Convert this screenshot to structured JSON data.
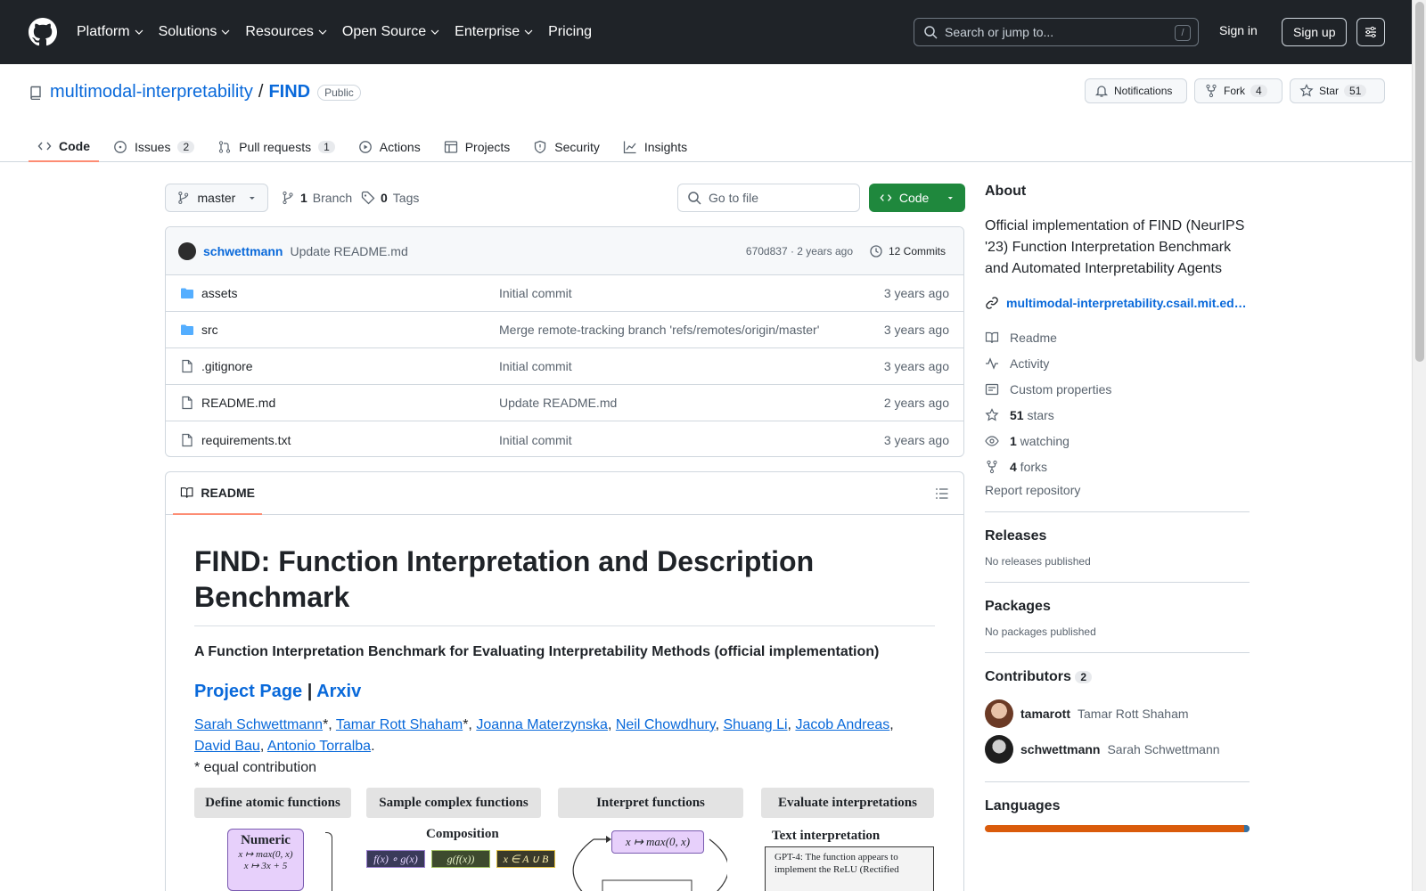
{
  "header": {
    "nav": [
      "Platform",
      "Solutions",
      "Resources",
      "Open Source",
      "Enterprise",
      "Pricing"
    ],
    "search_placeholder": "Search or jump to...",
    "search_shortcut": "/",
    "signin": "Sign in",
    "signup": "Sign up"
  },
  "repo": {
    "owner": "multimodal-interpretability",
    "separator": "/",
    "name": "FIND",
    "visibility": "Public",
    "notifications": "Notifications",
    "fork_label": "Fork",
    "fork_count": "4",
    "star_label": "Star",
    "star_count": "51"
  },
  "tabs": [
    {
      "label": "Code",
      "count": ""
    },
    {
      "label": "Issues",
      "count": "2"
    },
    {
      "label": "Pull requests",
      "count": "1"
    },
    {
      "label": "Actions",
      "count": ""
    },
    {
      "label": "Projects",
      "count": ""
    },
    {
      "label": "Security",
      "count": ""
    },
    {
      "label": "Insights",
      "count": ""
    }
  ],
  "toolbar": {
    "branch": "master",
    "branch_count": "1",
    "branch_label": "Branch",
    "tag_count": "0",
    "tag_label": "Tags",
    "goto_placeholder": "Go to file",
    "code_button": "Code"
  },
  "commit": {
    "author": "schwettmann",
    "message": "Update README.md",
    "hash_time": "670d837 · 2 years ago",
    "commits": "12 Commits"
  },
  "files": [
    {
      "name": "assets",
      "type": "folder",
      "message": "Initial commit",
      "date": "3 years ago"
    },
    {
      "name": "src",
      "type": "folder",
      "message": "Merge remote-tracking branch 'refs/remotes/origin/master'",
      "date": "3 years ago"
    },
    {
      "name": ".gitignore",
      "type": "file",
      "message": "Initial commit",
      "date": "3 years ago"
    },
    {
      "name": "README.md",
      "type": "file",
      "message": "Update README.md",
      "date": "2 years ago"
    },
    {
      "name": "requirements.txt",
      "type": "file",
      "message": "Initial commit",
      "date": "3 years ago"
    }
  ],
  "readme": {
    "tab": "README",
    "title": "FIND: Function Interpretation and Description Benchmark",
    "subtitle": "A Function Interpretation Benchmark for Evaluating Interpretability Methods (official implementation)",
    "link_project": "Project Page",
    "link_sep": "|",
    "link_arxiv": "Arxiv",
    "authors": [
      {
        "name": "Sarah Schwettmann",
        "suffix": "*, "
      },
      {
        "name": "Tamar Rott Shaham",
        "suffix": "*, "
      },
      {
        "name": "Joanna Materzynska",
        "suffix": ", "
      },
      {
        "name": "Neil Chowdhury",
        "suffix": ", "
      },
      {
        "name": "Shuang Li",
        "suffix": ", "
      },
      {
        "name": "Jacob Andreas",
        "suffix": ", "
      },
      {
        "name": "David Bau",
        "suffix": ", "
      },
      {
        "name": "Antonio Torralba",
        "suffix": "."
      }
    ],
    "note": "* equal contribution",
    "figure": {
      "headers": [
        "Define atomic functions",
        "Sample complex functions",
        "Interpret functions",
        "Evaluate interpretations"
      ],
      "numeric": "Numeric",
      "composition": "Composition",
      "ops": [
        "f(x) ∘ g(x)",
        "g(f(x))",
        "x ∈ A ∪ B"
      ],
      "relu": "x ↦ max(0, x)",
      "atomic_1": "x ↦ max(0, x)",
      "atomic_2": "x ↦ 3x + 5",
      "text_interp": "Text interpretation",
      "gpt4": "GPT-4: The function appears to implement the ReLU (Rectified"
    }
  },
  "about": {
    "heading": "About",
    "description": "Official implementation of FIND (NeurIPS '23) Function Interpretation Benchmark and Automated Interpretability Agents",
    "website": "multimodal-interpretability.csail.mit.ed…",
    "items": [
      {
        "icon": "book-icon",
        "bold": "",
        "text": "Readme"
      },
      {
        "icon": "pulse-icon",
        "bold": "",
        "text": "Activity"
      },
      {
        "icon": "note-icon",
        "bold": "",
        "text": "Custom properties"
      },
      {
        "icon": "star-icon",
        "bold": "51",
        "text": " stars"
      },
      {
        "icon": "eye-icon",
        "bold": "1",
        "text": " watching"
      },
      {
        "icon": "fork-icon",
        "bold": "4",
        "text": " forks"
      }
    ],
    "report": "Report repository"
  },
  "releases": {
    "heading": "Releases",
    "text": "No releases published"
  },
  "packages": {
    "heading": "Packages",
    "text": "No packages published"
  },
  "contributors": {
    "heading": "Contributors",
    "count": "2",
    "list": [
      {
        "login": "tamarott",
        "name": "Tamar Rott Shaham"
      },
      {
        "login": "schwettmann",
        "name": "Sarah Schwettmann"
      }
    ]
  },
  "languages": {
    "heading": "Languages"
  },
  "colors": {
    "accent": "#0969da",
    "code_green": "#1f883d",
    "tab_underline": "#fd8c73",
    "header_bg": "#1f2328"
  }
}
